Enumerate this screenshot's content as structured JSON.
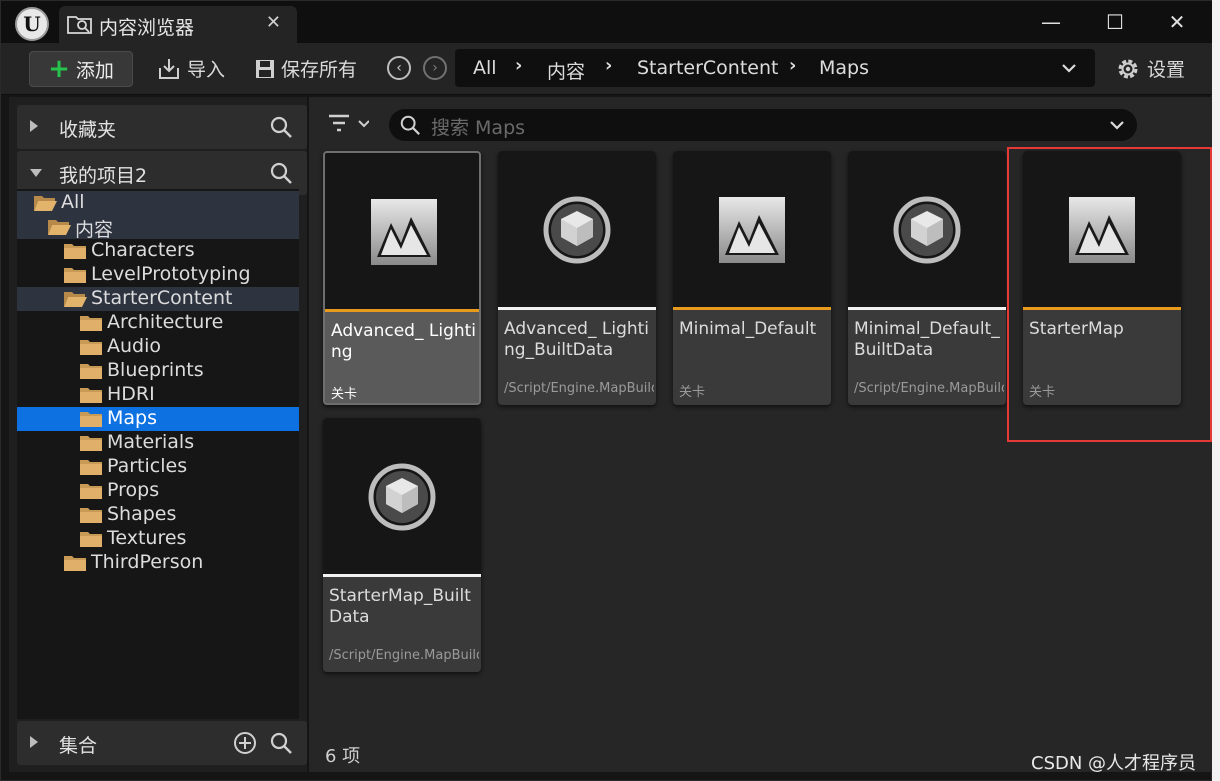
{
  "window": {
    "tab_title": "内容浏览器",
    "close_tab": "✕",
    "minimize": "—",
    "maximize": "☐",
    "close": "✕"
  },
  "toolbar": {
    "add_label": "添加",
    "import_label": "导入",
    "save_all_label": "保存所有",
    "settings_label": "设置",
    "breadcrumb": [
      "All",
      "内容",
      "StarterContent",
      "Maps"
    ]
  },
  "sidebar": {
    "favorites_label": "收藏夹",
    "project_label": "我的项目2",
    "collections_label": "集合",
    "tree": [
      {
        "label": "All",
        "indent": 0,
        "expanded": true
      },
      {
        "label": "内容",
        "indent": 1,
        "expanded": true
      },
      {
        "label": "Characters",
        "indent": 2,
        "expanded": false
      },
      {
        "label": "LevelPrototyping",
        "indent": 2,
        "expanded": false
      },
      {
        "label": "StarterContent",
        "indent": 2,
        "expanded": true
      },
      {
        "label": "Architecture",
        "indent": 3,
        "expanded": null
      },
      {
        "label": "Audio",
        "indent": 3,
        "expanded": null
      },
      {
        "label": "Blueprints",
        "indent": 3,
        "expanded": false
      },
      {
        "label": "HDRI",
        "indent": 3,
        "expanded": null
      },
      {
        "label": "Maps",
        "indent": 3,
        "expanded": null,
        "selected": true
      },
      {
        "label": "Materials",
        "indent": 3,
        "expanded": null
      },
      {
        "label": "Particles",
        "indent": 3,
        "expanded": false
      },
      {
        "label": "Props",
        "indent": 3,
        "expanded": false
      },
      {
        "label": "Shapes",
        "indent": 3,
        "expanded": null
      },
      {
        "label": "Textures",
        "indent": 3,
        "expanded": null
      },
      {
        "label": "ThirdPerson",
        "indent": 2,
        "expanded": false
      }
    ]
  },
  "content": {
    "search_placeholder": "搜索 Maps",
    "item_count": "6 项",
    "assets": [
      {
        "name": "Advanced_ Lighting",
        "type": "关卡",
        "icon": "level-icon",
        "bar_color": "#e89a1c",
        "selected": true
      },
      {
        "name": "Advanced_ Lighting_BuiltData",
        "type": "/Script/Engine.MapBuildDataRegistry",
        "icon": "data-icon",
        "bar_color": "#f2f2f2",
        "selected": false
      },
      {
        "name": "Minimal_Default",
        "type": "关卡",
        "icon": "level-icon",
        "bar_color": "#e89a1c",
        "selected": false
      },
      {
        "name": "Minimal_Default_ BuiltData",
        "type": "/Script/Engine.MapBuildDataRegistry",
        "icon": "data-icon",
        "bar_color": "#f2f2f2",
        "selected": false
      },
      {
        "name": "StarterMap",
        "type": "关卡",
        "icon": "level-icon",
        "bar_color": "#e89a1c",
        "selected": false
      },
      {
        "name": "StarterMap_Built Data",
        "type": "/Script/Engine.MapBuildDataRegistry",
        "icon": "data-icon",
        "bar_color": "#f2f2f2",
        "selected": false
      }
    ]
  },
  "watermark": "CSDN @人才程序员",
  "colors": {
    "accent_blue": "#0e71e2",
    "level_orange": "#e89a1c",
    "highlight_red": "#e53935",
    "add_green": "#27c24c"
  }
}
